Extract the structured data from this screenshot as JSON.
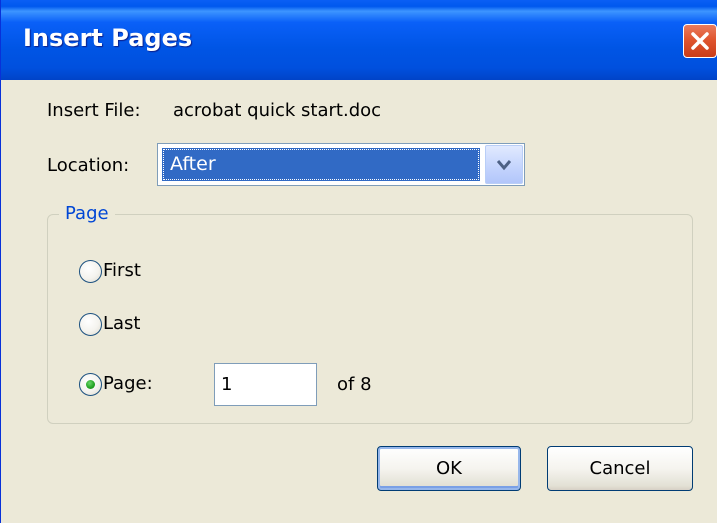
{
  "window": {
    "title": "Insert Pages"
  },
  "insert_file": {
    "label": "Insert File:",
    "value": "acrobat quick start.doc"
  },
  "location": {
    "label": "Location:",
    "selected": "After"
  },
  "page_group": {
    "label": "Page",
    "options": [
      {
        "label": "First",
        "selected": false
      },
      {
        "label": "Last",
        "selected": false
      },
      {
        "label": "Page:",
        "selected": true
      }
    ],
    "page_number": "1",
    "of_total": "of 8"
  },
  "buttons": {
    "ok": "OK",
    "cancel": "Cancel"
  },
  "icons": {
    "close": "close-icon",
    "dropdown": "chevron-down-icon"
  },
  "colors": {
    "titlebar": "#0055E5",
    "selection": "#316AC5",
    "group_label": "#0046D5",
    "close_button": "#E0552F",
    "radio_dot": "#21A121"
  }
}
